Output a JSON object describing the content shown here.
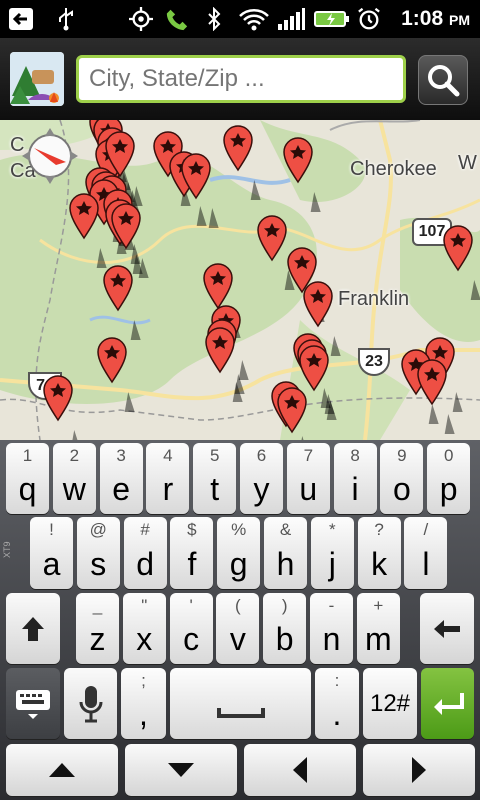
{
  "status_bar": {
    "time": "1:08",
    "time_suffix": "PM",
    "icons": [
      "back-arrow-icon",
      "usb-icon",
      "gps-icon",
      "phone-icon",
      "bluetooth-icon",
      "wifi-icon",
      "signal-icon",
      "battery-charging-icon",
      "alarm-icon"
    ]
  },
  "search": {
    "placeholder": "City, State/Zip ...",
    "button_icon": "magnifier-icon"
  },
  "map": {
    "labels": {
      "cherokee": "Cherokee",
      "franklin": "Franklin",
      "place_fragment_1": "C",
      "place_fragment_2": "Ca",
      "place_fragment_3": "W"
    },
    "shields": {
      "route_107": "107",
      "route_23": "23",
      "route_74": "74"
    },
    "compass_icon": "compass-icon",
    "marker_icon": "campground-pin-icon"
  },
  "keyboard": {
    "row1": [
      {
        "alt": "1",
        "main": "q"
      },
      {
        "alt": "2",
        "main": "w"
      },
      {
        "alt": "3",
        "main": "e"
      },
      {
        "alt": "4",
        "main": "r"
      },
      {
        "alt": "5",
        "main": "t"
      },
      {
        "alt": "6",
        "main": "y"
      },
      {
        "alt": "7",
        "main": "u"
      },
      {
        "alt": "8",
        "main": "i"
      },
      {
        "alt": "9",
        "main": "o"
      },
      {
        "alt": "0",
        "main": "p"
      }
    ],
    "row2": [
      {
        "alt": "!",
        "main": "a"
      },
      {
        "alt": "@",
        "main": "s"
      },
      {
        "alt": "#",
        "main": "d"
      },
      {
        "alt": "$",
        "main": "f"
      },
      {
        "alt": "%",
        "main": "g"
      },
      {
        "alt": "&",
        "main": "h"
      },
      {
        "alt": "*",
        "main": "j"
      },
      {
        "alt": "?",
        "main": "k"
      },
      {
        "alt": "/",
        "main": "l"
      }
    ],
    "row3": [
      {
        "alt": "_",
        "main": "z"
      },
      {
        "alt": "\"",
        "main": "x"
      },
      {
        "alt": "'",
        "main": "c"
      },
      {
        "alt": "(",
        "main": "v"
      },
      {
        "alt": ")",
        "main": "b"
      },
      {
        "alt": "-",
        "main": "n"
      },
      {
        "alt": "+",
        "main": "m"
      }
    ],
    "row4": {
      "punct_alt": ";",
      "punct_main": ",",
      "period_alt": ":",
      "period_main": ".",
      "symbols": "12#"
    },
    "side_label": "XT9",
    "colors": {
      "enter_green": "#5aa824",
      "search_border": "#9ed04a"
    }
  }
}
